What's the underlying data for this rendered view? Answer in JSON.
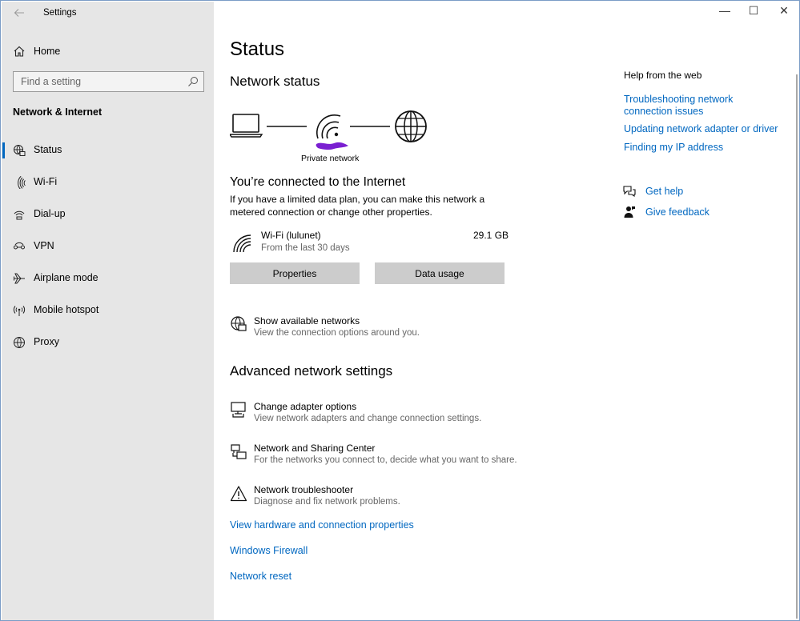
{
  "window": {
    "app_title": "Settings",
    "controls": {
      "minimize": "—",
      "maximize": "☐",
      "close": "✕"
    }
  },
  "sidebar": {
    "home_label": "Home",
    "search_placeholder": "Find a setting",
    "section_title": "Network & Internet",
    "items": [
      {
        "label": "Status",
        "icon": "status-globe-icon",
        "active": true
      },
      {
        "label": "Wi-Fi",
        "icon": "wifi-icon"
      },
      {
        "label": "Dial-up",
        "icon": "dialup-icon"
      },
      {
        "label": "VPN",
        "icon": "vpn-icon"
      },
      {
        "label": "Airplane mode",
        "icon": "airplane-icon"
      },
      {
        "label": "Mobile hotspot",
        "icon": "hotspot-icon"
      },
      {
        "label": "Proxy",
        "icon": "globe-icon"
      }
    ]
  },
  "main": {
    "title": "Status",
    "network_status_heading": "Network status",
    "diagram_label": "Private network",
    "connected_heading": "You’re connected to the Internet",
    "plan_text": "If you have a limited data plan, you can make this network a metered connection or change other properties.",
    "wifi": {
      "name": "Wi-Fi (lulunet)",
      "sub": "From the last 30 days",
      "usage": "29.1 GB"
    },
    "buttons": {
      "properties": "Properties",
      "data_usage": "Data usage"
    },
    "show_networks": {
      "title": "Show available networks",
      "sub": "View the connection options around you."
    },
    "advanced_heading": "Advanced network settings",
    "options": [
      {
        "title": "Change adapter options",
        "sub": "View network adapters and change connection settings."
      },
      {
        "title": "Network and Sharing Center",
        "sub": "For the networks you connect to, decide what you want to share."
      },
      {
        "title": "Network troubleshooter",
        "sub": "Diagnose and fix network problems."
      }
    ],
    "links": [
      "View hardware and connection properties",
      "Windows Firewall",
      "Network reset"
    ]
  },
  "help": {
    "heading": "Help from the web",
    "links": [
      "Troubleshooting network connection issues",
      "Updating network adapter or driver",
      "Finding my IP address"
    ],
    "get_help": "Get help",
    "give_feedback": "Give feedback"
  },
  "colors": {
    "accent": "#0067c0",
    "sidebar_bg": "#e6e6e6",
    "button_bg": "#cccccc",
    "redaction": "#7a1fd1"
  }
}
